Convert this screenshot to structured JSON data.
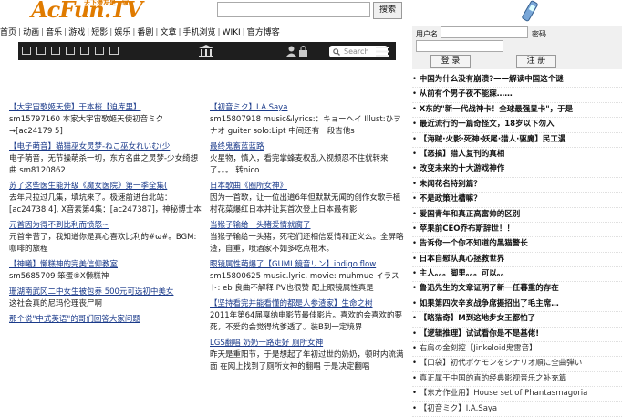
{
  "header": {
    "logo_text": "AcFun.TV",
    "logo_slogan": "天下漫友是一家",
    "search_placeholder": "",
    "search_button": "搜索"
  },
  "nav": [
    "首页",
    "动画",
    "音乐",
    "游戏",
    "短影",
    "娱乐",
    "番剧",
    "文章",
    "手机浏览",
    "WIKI",
    "官方博客"
  ],
  "toolbar": {
    "search_placeholder": "Search",
    "icons": [
      "window-icon",
      "film-icon",
      "grid-icon",
      "tablet-icon",
      "music-icon",
      "media-icon",
      "book-icon",
      "bank-icon",
      "user-icon",
      "lock-icon",
      "search-icon",
      "menu-icon"
    ]
  },
  "login": {
    "username_label": "用户名",
    "password_label": "密码",
    "login_button": "登 录",
    "register_button": "注 册"
  },
  "left_col": [
    {
      "title": "【大宇宙歌姬天使】干本桜【迫库里】",
      "desc": "sm15797160 本家大宇宙歌姬天使初音ミク→[ac24179 5]"
    },
    {
      "title": "【电子萌音】猫猫巫女灵梦-ねこ巫女れいむ(少",
      "desc": "电子萌音，无节操萌杀一切，东方名曲之灵梦-少女绮想曲 sm8120862"
    },
    {
      "title": "苏了这些医生能升级《魔女医院》第一季全集(",
      "desc": "去年只拉过几集，填坑来了。极速前进台北站：[ac24738 4], X音素第4集：[ac247387]，神秘博士本"
    },
    {
      "title": "元首因为得不到比利而愤怒~",
      "desc": "元首辛苦了，我知道你是真心喜欢比利的#ω#。BGM:咖啡的旅程"
    },
    {
      "title": "【神曦】懒糕神的完美信仰教室",
      "desc": "sm5685709 笨蛋⑨X懒糕神"
    },
    {
      "title": "珊湖南武冈二中女生被包养 500元可选初中美女",
      "desc": "这社会真的尼玛伦理丧尸啊"
    },
    {
      "title": "那个说\"中式英语\"的哥们回答大家问题",
      "desc": ""
    }
  ],
  "mid_col": [
    {
      "title": "【初音ミク】I.A.Saya",
      "desc": "sm15807918 music&lyrics:：キョーヘイ Illust:ひヲナオ guiter solo:Lipt 中间还有一段吉他s"
    },
    {
      "title": "最终鬼畜蓝蓝路",
      "desc": "火星物，慎入，看完掌蜂麦权乱入视频忍不住就转来了。。。 转nico"
    },
    {
      "title": "日本歌曲《圈所女神》",
      "desc": "因为一首歌，让一位出道6年但默默无闻的创作女歌手植村花菜爆红日本并让其首次登上日本最有影"
    },
    {
      "title": "当猴子输给一头猪爱情就腐了",
      "desc": "当猴子输给一头猪，死宅们还相信爱情和正义么。全屏略渣，自重，喷酒家不如多吃点根木。"
    },
    {
      "title": "眼镜属性萌爆了【GUMI 鏡音リン】indigo flow",
      "desc": "sm15800625 music.lyric, movie: muhmue イラスト: eb 良曲不解释 PV也很赞 配上眼镜属性真是"
    },
    {
      "title": "【坚持看完并能看懂的都是人参渣家】生命之树",
      "desc": "2011年第64届戛纳电影节最佳影片。喜欢的会喜欢的要死，不爱的会觉得坑爹透了。装B到一定境界"
    },
    {
      "title": "LGS翻唱 奶奶一路走好 厕所女神",
      "desc": "昨天是重阳节，于是想起了年初过世的奶奶，顿时内流满面 在网上找到了厕所女神的翻唱 于是决定翻唱"
    }
  ],
  "right_col": [
    {
      "bold": "中国为什么没有崩溃?——解读中国这个谜",
      "normal": ""
    },
    {
      "bold": "从前有个男子夜不能寐……",
      "normal": ""
    },
    {
      "bold": "X东的\"新一代战神卡！全球最强显卡\"，于是",
      "normal": ""
    },
    {
      "bold": "最近流行的一篇奇怪文，18岁以下勿入",
      "normal": ""
    },
    {
      "bold": "【海贼·火影·死神·妖尾·猎人·驱魔】民工漫",
      "normal": ""
    },
    {
      "bold": "【恶搞】猎人复刊的真相",
      "normal": ""
    },
    {
      "bold": "改变未来的十大游戏神作",
      "normal": ""
    },
    {
      "bold": "未闻花名特别篇？",
      "normal": ""
    },
    {
      "bold": "不是政策吐槽嘛？",
      "normal": ""
    },
    {
      "bold": "爱国青年和真正高富帅的区别",
      "normal": ""
    },
    {
      "bold": "苹果前CEO乔布斯辞世！！",
      "normal": ""
    },
    {
      "bold": "告诉你一个你不知道的黑猫警长",
      "normal": ""
    },
    {
      "bold": "日本自慰队真心拯救世界",
      "normal": ""
    },
    {
      "bold": "主人。。。脚里。。。可以。。",
      "normal": ""
    },
    {
      "bold": "鲁迅先生的文章证明了新一任暮重的存在",
      "normal": ""
    },
    {
      "bold": "如果第四次辛亥战争席摄招出了毛主席…",
      "normal": ""
    },
    {
      "bold": "【略猫奇】M到这地步女王都怕了",
      "normal": ""
    },
    {
      "bold": "【逻辑推理】试试看你是不是基佬!",
      "normal": ""
    },
    {
      "bold": "",
      "normal": "右肩の金刻控【Jinkeloid鬼雷音】"
    },
    {
      "bold": "",
      "normal": "【口袋】初代ポケモンをシナリオ順に全曲弾い"
    },
    {
      "bold": "",
      "normal": "真正属于中国的直的经典影视音乐之补充篇"
    },
    {
      "bold": "",
      "normal": "【东方作业用】House set of Phantasmagoria"
    },
    {
      "bold": "",
      "normal": "【初音ミク】I.A.Saya"
    }
  ]
}
